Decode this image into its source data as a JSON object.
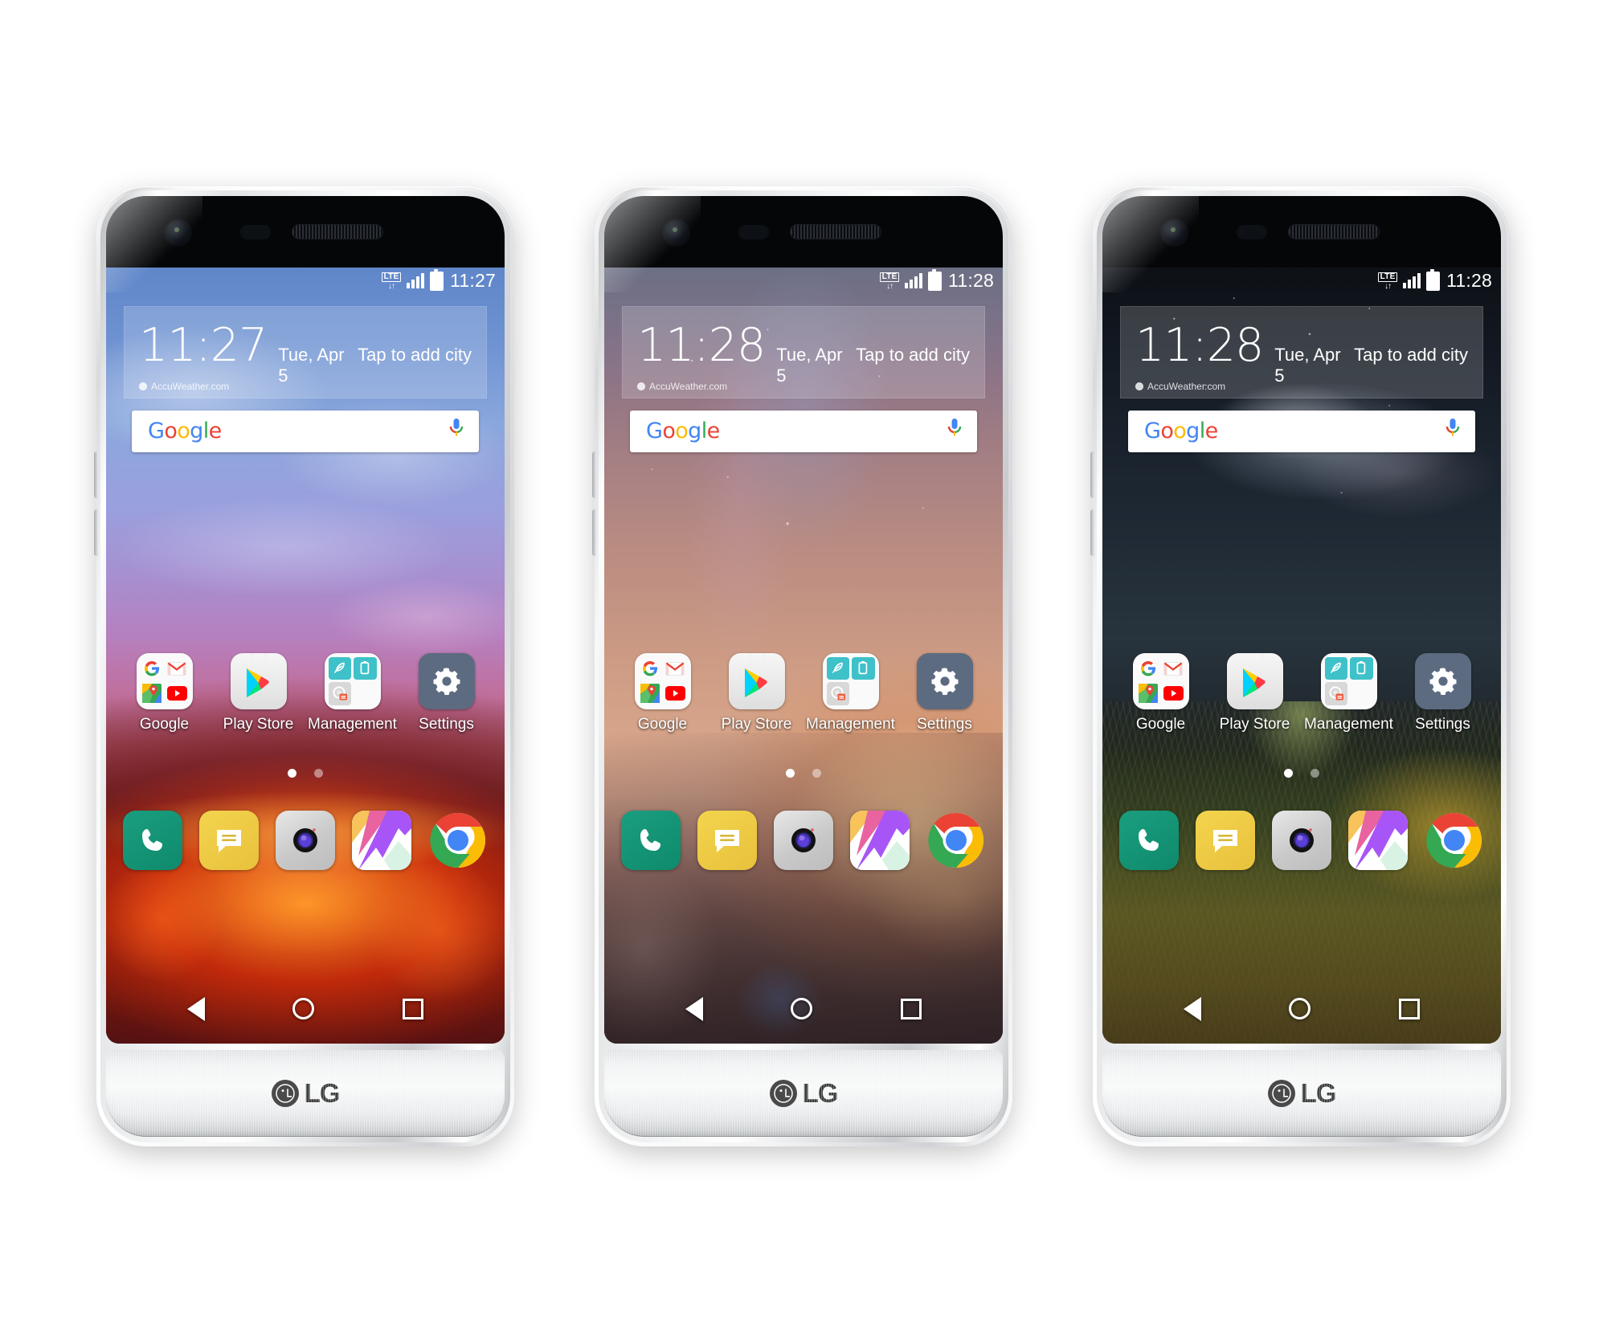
{
  "page": {
    "title": "LG G5 home screens",
    "device_brand": "LG",
    "background_color": "#ffffff"
  },
  "shared": {
    "status_bar": {
      "network_label": "LTE",
      "data_arrows": "↓↑",
      "signal_icon": "signal-bars-icon",
      "battery_icon": "battery-full-icon"
    },
    "widget": {
      "date": "Tue, Apr 5",
      "city_prompt": "Tap to add city",
      "source": "AccuWeather.com"
    },
    "search": {
      "logo_letters": [
        {
          "ch": "G",
          "color": "#4285F4"
        },
        {
          "ch": "o",
          "color": "#EA4335"
        },
        {
          "ch": "o",
          "color": "#FBBC05"
        },
        {
          "ch": "g",
          "color": "#4285F4"
        },
        {
          "ch": "l",
          "color": "#34A853"
        },
        {
          "ch": "e",
          "color": "#EA4335"
        }
      ],
      "logo_text": "Google",
      "mic_icon": "microphone-icon"
    },
    "apps": [
      {
        "label": "Google",
        "icon": "google-folder-icon"
      },
      {
        "label": "Play Store",
        "icon": "play-store-icon"
      },
      {
        "label": "Management",
        "icon": "management-folder-icon"
      },
      {
        "label": "Settings",
        "icon": "settings-gear-icon"
      }
    ],
    "dock": [
      {
        "label": "Phone",
        "icon": "phone-icon"
      },
      {
        "label": "Messages",
        "icon": "message-bubble-icon"
      },
      {
        "label": "Camera",
        "icon": "camera-icon"
      },
      {
        "label": "Gallery",
        "icon": "gallery-icon"
      },
      {
        "label": "Chrome",
        "icon": "chrome-icon"
      }
    ],
    "nav": [
      {
        "label": "Back",
        "icon": "back-triangle-icon"
      },
      {
        "label": "Home",
        "icon": "home-circle-icon"
      },
      {
        "label": "Recents",
        "icon": "recents-square-icon"
      }
    ],
    "brand_text": "LG",
    "page_dot_count": 2,
    "page_dot_active_index": 0,
    "colors": {
      "google_blue": "#4285F4",
      "google_red": "#EA4335",
      "google_yellow": "#FBBC05",
      "google_green": "#34A853",
      "settings_tile": "#5c6b80",
      "management_cyan": "#3fc1c9",
      "phone_teal": "#0f8a6c",
      "message_yellow": "#e9c13c",
      "chin_silver": "#eceef0"
    }
  },
  "phones": [
    {
      "id": "phone-left",
      "wallpaper": "blue-sky-lava-field",
      "status_time": "11:27",
      "widget_time": "11:27"
    },
    {
      "id": "phone-center",
      "wallpaper": "rose-tan-desert-night-sky",
      "status_time": "11:28",
      "widget_time": "11:28"
    },
    {
      "id": "phone-right",
      "wallpaper": "dark-milky-way-over-grass",
      "status_time": "11:28",
      "widget_time": "11:28"
    }
  ]
}
